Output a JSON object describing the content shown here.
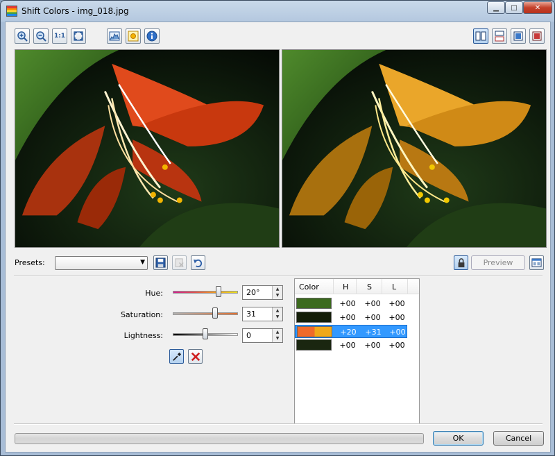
{
  "window": {
    "title": "Shift Colors - img_018.jpg"
  },
  "presets": {
    "label": "Presets:",
    "selected": ""
  },
  "buttons": {
    "preview": "Preview",
    "ok": "OK",
    "cancel": "Cancel"
  },
  "toolbar": {
    "zoom_1_1": "1:1"
  },
  "adjust": {
    "hue": {
      "label": "Hue:",
      "value": "20°",
      "position": 0.72
    },
    "saturation": {
      "label": "Saturation:",
      "value": "31",
      "position": 0.66
    },
    "lightness": {
      "label": "Lightness:",
      "value": "0",
      "position": 0.5
    }
  },
  "color_table": {
    "headers": [
      "Color",
      "H",
      "S",
      "L"
    ],
    "rows": [
      {
        "h": "+00",
        "s": "+00",
        "l": "+00",
        "swatch": "#3c6a1e",
        "swatch2": "#3c6a1e",
        "selected": false
      },
      {
        "h": "+00",
        "s": "+00",
        "l": "+00",
        "swatch": "#141e08",
        "swatch2": "#141e08",
        "selected": false
      },
      {
        "h": "+20",
        "s": "+31",
        "l": "+00",
        "swatch": "#f06a2a",
        "swatch2": "#f0a81a",
        "selected": true
      },
      {
        "h": "+00",
        "s": "+00",
        "l": "+00",
        "swatch": "#1a2610",
        "swatch2": "#1a2610",
        "selected": false
      }
    ]
  },
  "colors": {
    "accent": "#3399ff",
    "original_petal": "#d9451a",
    "shifted_petal": "#e8a21e"
  }
}
